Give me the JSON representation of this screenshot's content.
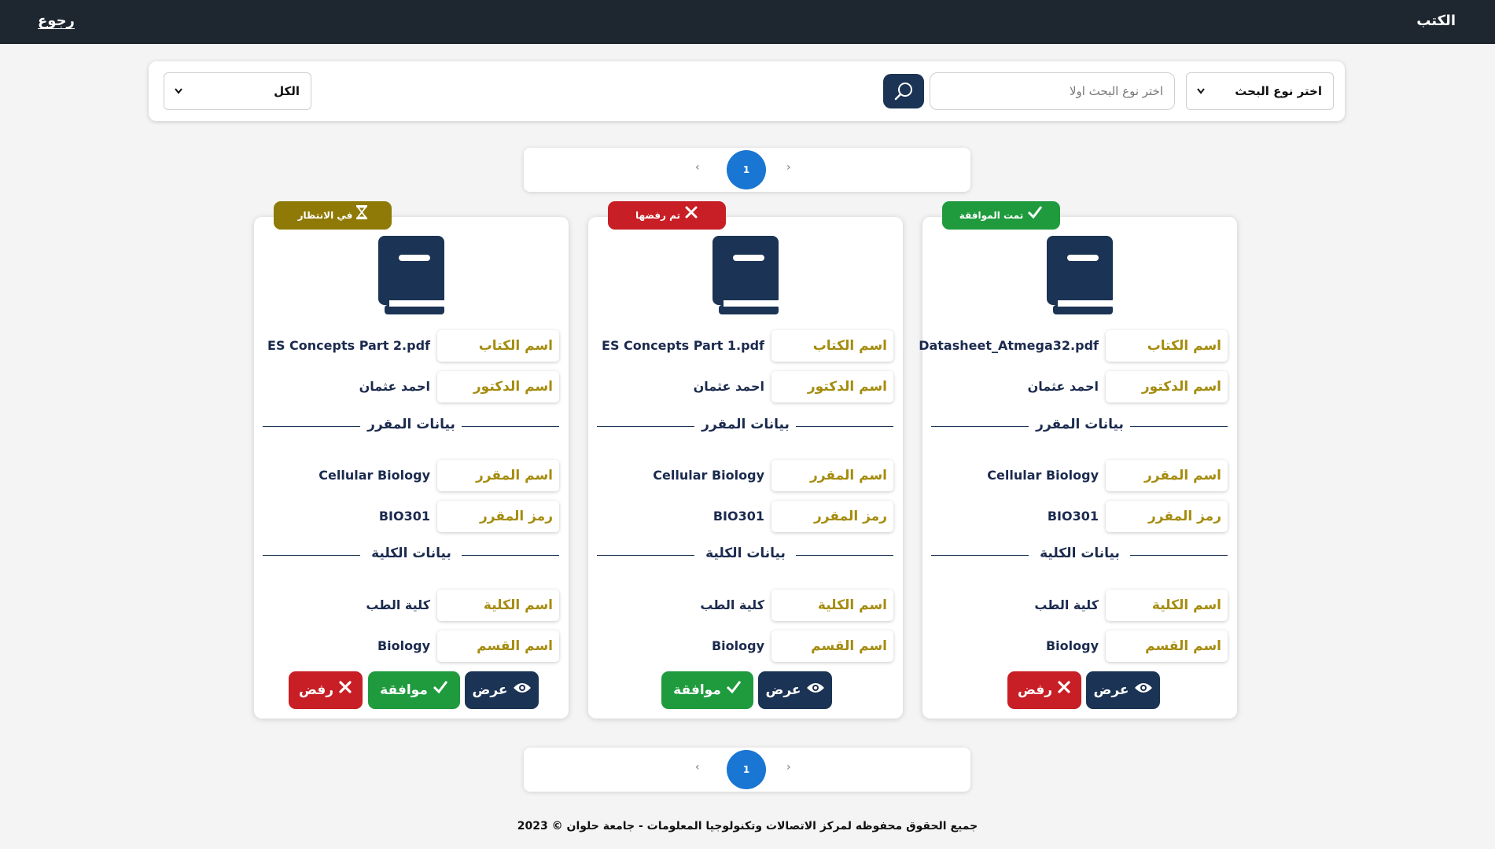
{
  "header": {
    "title": "الكتب",
    "back_label": "رجوع"
  },
  "search": {
    "type_select_value": "اختر نوع البحث",
    "input_placeholder": "اختر نوع البحث اولا",
    "filter_select_value": "الكل"
  },
  "pagination": {
    "prev": "‹",
    "next": "›",
    "current_page": "1"
  },
  "cards": [
    {
      "status_label": "تمت الموافقة",
      "status_color": "#1f9b3e",
      "book_label": "اسم الكتاب",
      "book_value": "Datasheet_Atmega32.pdf",
      "doctor_label": "اسم الدكتور",
      "doctor_value": "احمد عثمان",
      "course_section": "بيانات المقرر",
      "course_name_label": "اسم المقرر",
      "course_name_value": "Cellular Biology",
      "course_code_label": "رمز المقرر",
      "course_code_value": "BIO301",
      "faculty_section": "بيانات الكلية",
      "faculty_label": "اسم الكلية",
      "faculty_value": "كلية الطب",
      "dept_label": "اسم القسم",
      "dept_value": "Biology",
      "view_label": "عرض",
      "reject_label": "رفض"
    },
    {
      "status_label": "تم رفضها",
      "status_color": "#c81e25",
      "book_label": "اسم الكتاب",
      "book_value": "ES Concepts Part 1.pdf",
      "doctor_label": "اسم الدكتور",
      "doctor_value": "احمد عثمان",
      "course_section": "بيانات المقرر",
      "course_name_label": "اسم المقرر",
      "course_name_value": "Cellular Biology",
      "course_code_label": "رمز المقرر",
      "course_code_value": "BIO301",
      "faculty_section": "بيانات الكلية",
      "faculty_label": "اسم الكلية",
      "faculty_value": "كلية الطب",
      "dept_label": "اسم القسم",
      "dept_value": "Biology",
      "view_label": "عرض",
      "approve_label": "موافقة"
    },
    {
      "status_label": "في الانتظار",
      "status_color": "#8f7a07",
      "book_label": "اسم الكتاب",
      "book_value": "ES Concepts Part 2.pdf",
      "doctor_label": "اسم الدكتور",
      "doctor_value": "احمد عثمان",
      "course_section": "بيانات المقرر",
      "course_name_label": "اسم المقرر",
      "course_name_value": "Cellular Biology",
      "course_code_label": "رمز المقرر",
      "course_code_value": "BIO301",
      "faculty_section": "بيانات الكلية",
      "faculty_label": "اسم الكلية",
      "faculty_value": "كلية الطب",
      "dept_label": "اسم القسم",
      "dept_value": "Biology",
      "view_label": "عرض",
      "approve_label": "موافقة",
      "reject_label": "رفض"
    }
  ],
  "icons": {
    "search": "search-icon",
    "book": "book-icon",
    "approved": "check-icon",
    "rejected": "x-icon",
    "pending": "hourglass-icon",
    "view": "eye-icon"
  },
  "colors": {
    "navy": "#1b3354",
    "gold_label": "#a58c0f",
    "topbar": "#1e2630",
    "page_active": "#1976d2"
  },
  "footer": {
    "text": "جميع الحقوق محفوظه لمركز الاتصالات وتكنولوجيا المعلومات - جامعة حلوان © 2023"
  }
}
